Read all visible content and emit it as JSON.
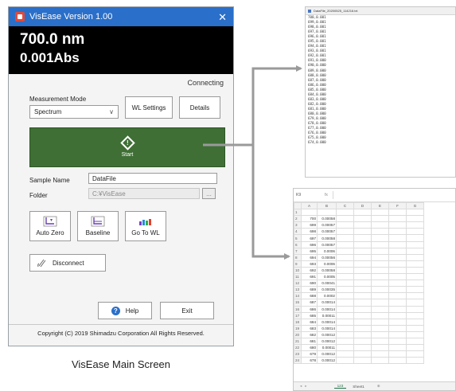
{
  "main_window": {
    "title": "VisEase Version 1.00",
    "close_glyph": "✕",
    "wavelength": "700.0 nm",
    "absorbance": "0.001Abs",
    "status": "Connecting",
    "mode_label": "Measurement Mode",
    "mode_value": "Spectrum",
    "wl_settings_label": "WL Settings",
    "details_label": "Details",
    "start_label": "Start",
    "sample_name_label": "Sample Name",
    "sample_name_value": "DataFile",
    "folder_label": "Folder",
    "folder_value": "C:¥VisEase",
    "browse_label": "...",
    "auto_zero_label": "Auto Zero",
    "baseline_label": "Baseline",
    "goto_wl_label": "Go To WL",
    "disconnect_label": "Disconnect",
    "help_label": "Help",
    "exit_label": "Exit",
    "copyright": "Copyright (C) 2019 Shimadzu Corporation All Rights Reserved."
  },
  "caption": "VisEase Main Screen",
  "accent_colors": {
    "start_button": "#3f6f35",
    "titlebar": "#2a6fc9",
    "readout_bg": "#000000"
  },
  "notepad": {
    "title": "DataFile_20200525_114216.txt",
    "lines": [
      "700,0.001",
      "699,0.001",
      "698,0.001",
      "697,0.001",
      "696,0.001",
      "695,0.001",
      "694,0.001",
      "693,0.001",
      "692,0.001",
      "691,0.000",
      "690,0.000",
      "689,0.000",
      "688,0.000",
      "687,0.000",
      "686,0.000",
      "685,0.000",
      "684,0.000",
      "683,0.000",
      "682,0.000",
      "681,0.000",
      "680,0.000",
      "679,0.000",
      "678,0.000",
      "677,0.000",
      "676,0.000",
      "675,0.000",
      "674,0.000"
    ]
  },
  "spreadsheet": {
    "name_box": "K9",
    "fx": "fx",
    "columns": [
      "A",
      "B",
      "C",
      "D",
      "E",
      "F",
      "G"
    ],
    "rows": [
      [
        "1",
        "",
        ""
      ],
      [
        "2",
        "700",
        "0.00058"
      ],
      [
        "3",
        "699",
        "0.00057"
      ],
      [
        "4",
        "698",
        "0.00057"
      ],
      [
        "5",
        "697",
        "0.00058"
      ],
      [
        "6",
        "696",
        "0.00057"
      ],
      [
        "7",
        "695",
        "0.0006"
      ],
      [
        "8",
        "694",
        "0.00056"
      ],
      [
        "9",
        "693",
        "0.0006"
      ],
      [
        "10",
        "692",
        "0.00058"
      ],
      [
        "11",
        "691",
        "0.0005"
      ],
      [
        "12",
        "690",
        "0.00041"
      ],
      [
        "13",
        "689",
        "0.00035"
      ],
      [
        "14",
        "688",
        "0.0002"
      ],
      [
        "15",
        "687",
        "0.00014"
      ],
      [
        "16",
        "686",
        "0.00014"
      ],
      [
        "17",
        "685",
        "0.00011"
      ],
      [
        "18",
        "684",
        "0.00014"
      ],
      [
        "19",
        "683",
        "0.00014"
      ],
      [
        "20",
        "682",
        "0.00012"
      ],
      [
        "21",
        "681",
        "0.00012"
      ],
      [
        "22",
        "680",
        "0.00011"
      ],
      [
        "23",
        "679",
        "0.00012"
      ],
      [
        "24",
        "678",
        "0.00012"
      ]
    ],
    "tab_active": "123",
    "tab_other": "Sheet1",
    "add_sheet": "⊕"
  }
}
